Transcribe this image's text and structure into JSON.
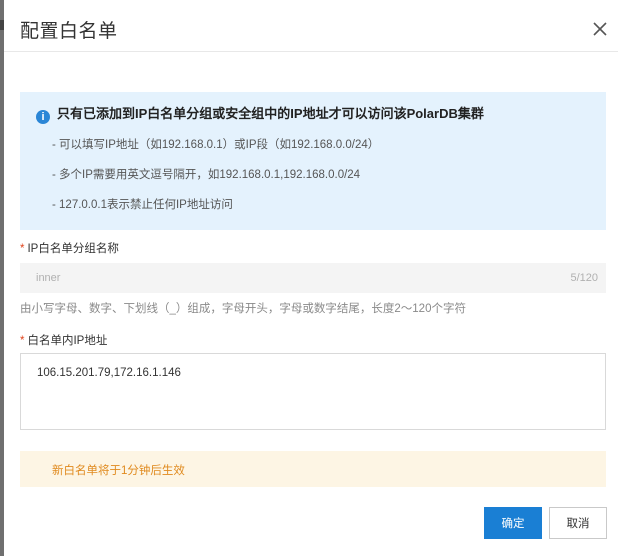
{
  "dialog": {
    "title": "配置白名单"
  },
  "notice": {
    "heading": "只有已添加到IP白名单分组或安全组中的IP地址才可以访问该PolarDB集群",
    "lines": [
      "- 可以填写IP地址（如192.168.0.1）或IP段（如192.168.0.0/24）",
      "- 多个IP需要用英文逗号隔开，如192.168.0.1,192.168.0.0/24",
      "- 127.0.0.1表示禁止任何IP地址访问"
    ]
  },
  "group_name": {
    "required_mark": "*",
    "label": "IP白名单分组名称",
    "value": "inner",
    "count": "5/120",
    "hint": "由小写字母、数字、下划线（_）组成，字母开头，字母或数字结尾，长度2～120个字符"
  },
  "ip_list": {
    "required_mark": "*",
    "label": "白名单内IP地址",
    "value": "106.15.201.79,172.16.1.146"
  },
  "warning": {
    "text": "新白名单将于1分钟后生效"
  },
  "buttons": {
    "ok": "确定",
    "cancel": "取消"
  },
  "colors": {
    "primary": "#1a7fd4",
    "info_bg": "#e4f2fd",
    "warn_bg": "#fdf5e4",
    "warn_text": "#e08a1e",
    "required": "#e0451d"
  },
  "icons": {
    "info": "info-icon",
    "close": "close-icon"
  }
}
